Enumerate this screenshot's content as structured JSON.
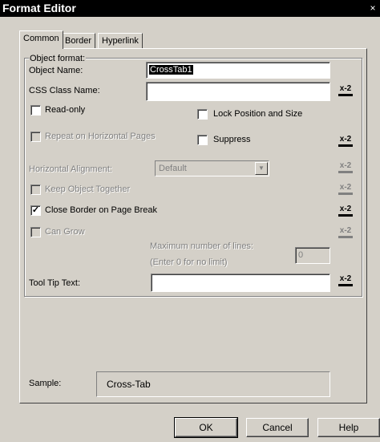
{
  "window": {
    "title": "Format Editor",
    "close_glyph": "×"
  },
  "tabs": [
    {
      "label": "Common"
    },
    {
      "label": "Border"
    },
    {
      "label": "Hyperlink"
    }
  ],
  "object_format": {
    "group_label": "Object format:",
    "object_name_label": "Object Name:",
    "object_name_value": "CrossTab1",
    "css_class_label": "CSS Class Name:",
    "css_class_value": "",
    "read_only_label": "Read-only",
    "lock_position_label": "Lock Position and Size",
    "repeat_horizontal_label": "Repeat on Horizontal Pages",
    "suppress_label": "Suppress",
    "horizontal_alignment_label": "Horizontal Alignment:",
    "horizontal_alignment_value": "Default",
    "keep_together_label": "Keep Object Together",
    "close_border_label": "Close Border on Page Break",
    "close_border_checked": "✓",
    "can_grow_label": "Can Grow",
    "max_lines_label": "Maximum number of lines:",
    "max_lines_hint": "(Enter 0 for no limit)",
    "max_lines_value": "0",
    "tooltip_label": "Tool Tip Text:",
    "tooltip_value": ""
  },
  "formula_button": {
    "top": "x-2",
    "icon": "formula-icon"
  },
  "sample": {
    "label": "Sample:",
    "value": "Cross-Tab"
  },
  "buttons": {
    "ok": "OK",
    "cancel": "Cancel",
    "help": "Help"
  }
}
